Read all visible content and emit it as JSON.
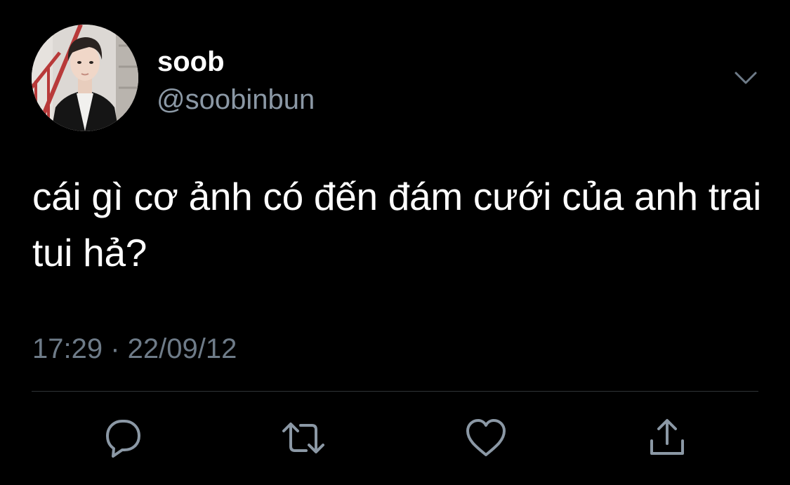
{
  "tweet": {
    "display_name": "soob",
    "handle": "@soobinbun",
    "text": "cái gì cơ ảnh có đến đám cưới của anh trai tui hả?",
    "timestamp": "17:29 · 22/09/12"
  },
  "icons": {
    "more": "chevron-down-icon",
    "reply": "reply-icon",
    "retweet": "retweet-icon",
    "like": "heart-icon",
    "share": "share-icon"
  },
  "colors": {
    "background": "#000000",
    "text": "#ffffff",
    "secondary": "#8b98a5",
    "icon": "#8b98a5",
    "divider": "#2f3336"
  }
}
